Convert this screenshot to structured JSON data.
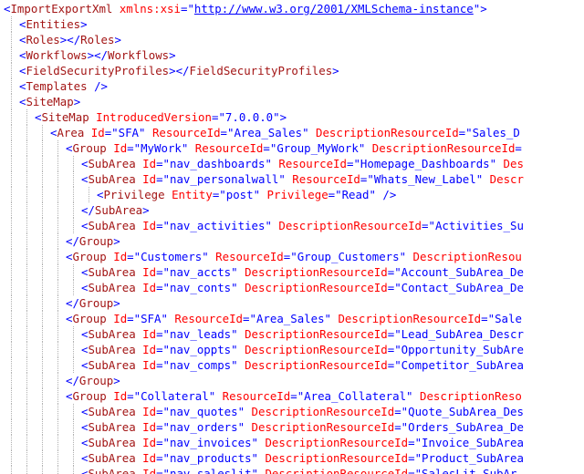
{
  "document": {
    "type": "xml",
    "colors": {
      "punctuation": "#0000ff",
      "element_name": "#a31515",
      "attribute_name": "#ff0000",
      "attribute_value": "#0000ff",
      "indent_guide": "#b0b0b0"
    },
    "lines": [
      {
        "indent": 0,
        "tokens": [
          {
            "k": "p",
            "t": "<"
          },
          {
            "k": "n",
            "t": "ImportExportXml"
          },
          {
            "k": "a",
            "t": " xmlns:xsi"
          },
          {
            "k": "p",
            "t": "=\""
          },
          {
            "k": "l",
            "t": "http://www.w3.org/2001/XMLSchema-instance"
          },
          {
            "k": "p",
            "t": "\">"
          }
        ]
      },
      {
        "indent": 1,
        "tokens": [
          {
            "k": "p",
            "t": "<"
          },
          {
            "k": "n",
            "t": "Entities"
          },
          {
            "k": "p",
            "t": ">"
          }
        ]
      },
      {
        "indent": 1,
        "tokens": [
          {
            "k": "p",
            "t": "<"
          },
          {
            "k": "n",
            "t": "Roles"
          },
          {
            "k": "p",
            "t": "></"
          },
          {
            "k": "n",
            "t": "Roles"
          },
          {
            "k": "p",
            "t": ">"
          }
        ]
      },
      {
        "indent": 1,
        "tokens": [
          {
            "k": "p",
            "t": "<"
          },
          {
            "k": "n",
            "t": "Workflows"
          },
          {
            "k": "p",
            "t": "></"
          },
          {
            "k": "n",
            "t": "Workflows"
          },
          {
            "k": "p",
            "t": ">"
          }
        ]
      },
      {
        "indent": 1,
        "tokens": [
          {
            "k": "p",
            "t": "<"
          },
          {
            "k": "n",
            "t": "FieldSecurityProfiles"
          },
          {
            "k": "p",
            "t": "></"
          },
          {
            "k": "n",
            "t": "FieldSecurityProfiles"
          },
          {
            "k": "p",
            "t": ">"
          }
        ]
      },
      {
        "indent": 1,
        "tokens": [
          {
            "k": "p",
            "t": "<"
          },
          {
            "k": "n",
            "t": "Templates"
          },
          {
            "k": "p",
            "t": " />"
          }
        ]
      },
      {
        "indent": 1,
        "tokens": [
          {
            "k": "p",
            "t": "<"
          },
          {
            "k": "n",
            "t": "SiteMap"
          },
          {
            "k": "p",
            "t": ">"
          }
        ]
      },
      {
        "indent": 2,
        "tokens": [
          {
            "k": "p",
            "t": "<"
          },
          {
            "k": "n",
            "t": "SiteMap"
          },
          {
            "k": "a",
            "t": " IntroducedVersion"
          },
          {
            "k": "p",
            "t": "="
          },
          {
            "k": "v",
            "t": "\"7.0.0.0\""
          },
          {
            "k": "p",
            "t": ">"
          }
        ]
      },
      {
        "indent": 3,
        "tokens": [
          {
            "k": "p",
            "t": "<"
          },
          {
            "k": "n",
            "t": "Area"
          },
          {
            "k": "a",
            "t": " Id"
          },
          {
            "k": "p",
            "t": "="
          },
          {
            "k": "v",
            "t": "\"SFA\""
          },
          {
            "k": "a",
            "t": " ResourceId"
          },
          {
            "k": "p",
            "t": "="
          },
          {
            "k": "v",
            "t": "\"Area_Sales\""
          },
          {
            "k": "a",
            "t": " DescriptionResourceId"
          },
          {
            "k": "p",
            "t": "="
          },
          {
            "k": "v",
            "t": "\"Sales_D"
          }
        ]
      },
      {
        "indent": 4,
        "tokens": [
          {
            "k": "p",
            "t": "<"
          },
          {
            "k": "n",
            "t": "Group"
          },
          {
            "k": "a",
            "t": " Id"
          },
          {
            "k": "p",
            "t": "="
          },
          {
            "k": "v",
            "t": "\"MyWork\""
          },
          {
            "k": "a",
            "t": " ResourceId"
          },
          {
            "k": "p",
            "t": "="
          },
          {
            "k": "v",
            "t": "\"Group_MyWork\""
          },
          {
            "k": "a",
            "t": " DescriptionResourceId"
          },
          {
            "k": "p",
            "t": "="
          }
        ]
      },
      {
        "indent": 5,
        "tokens": [
          {
            "k": "p",
            "t": "<"
          },
          {
            "k": "n",
            "t": "SubArea"
          },
          {
            "k": "a",
            "t": " Id"
          },
          {
            "k": "p",
            "t": "="
          },
          {
            "k": "v",
            "t": "\"nav_dashboards\""
          },
          {
            "k": "a",
            "t": " ResourceId"
          },
          {
            "k": "p",
            "t": "="
          },
          {
            "k": "v",
            "t": "\"Homepage_Dashboards\""
          },
          {
            "k": "a",
            "t": " Des"
          }
        ]
      },
      {
        "indent": 5,
        "tokens": [
          {
            "k": "p",
            "t": "<"
          },
          {
            "k": "n",
            "t": "SubArea"
          },
          {
            "k": "a",
            "t": " Id"
          },
          {
            "k": "p",
            "t": "="
          },
          {
            "k": "v",
            "t": "\"nav_personalwall\""
          },
          {
            "k": "a",
            "t": " ResourceId"
          },
          {
            "k": "p",
            "t": "="
          },
          {
            "k": "v",
            "t": "\"Whats_New_Label\""
          },
          {
            "k": "a",
            "t": " Descr"
          }
        ]
      },
      {
        "indent": 6,
        "tokens": [
          {
            "k": "p",
            "t": "<"
          },
          {
            "k": "n",
            "t": "Privilege"
          },
          {
            "k": "a",
            "t": " Entity"
          },
          {
            "k": "p",
            "t": "="
          },
          {
            "k": "v",
            "t": "\"post\""
          },
          {
            "k": "a",
            "t": " Privilege"
          },
          {
            "k": "p",
            "t": "="
          },
          {
            "k": "v",
            "t": "\"Read\""
          },
          {
            "k": "p",
            "t": " />"
          }
        ]
      },
      {
        "indent": 5,
        "tokens": [
          {
            "k": "p",
            "t": "</"
          },
          {
            "k": "n",
            "t": "SubArea"
          },
          {
            "k": "p",
            "t": ">"
          }
        ]
      },
      {
        "indent": 5,
        "tokens": [
          {
            "k": "p",
            "t": "<"
          },
          {
            "k": "n",
            "t": "SubArea"
          },
          {
            "k": "a",
            "t": " Id"
          },
          {
            "k": "p",
            "t": "="
          },
          {
            "k": "v",
            "t": "\"nav_activities\""
          },
          {
            "k": "a",
            "t": " DescriptionResourceId"
          },
          {
            "k": "p",
            "t": "="
          },
          {
            "k": "v",
            "t": "\"Activities_Su"
          }
        ]
      },
      {
        "indent": 4,
        "tokens": [
          {
            "k": "p",
            "t": "</"
          },
          {
            "k": "n",
            "t": "Group"
          },
          {
            "k": "p",
            "t": ">"
          }
        ]
      },
      {
        "indent": 4,
        "tokens": [
          {
            "k": "p",
            "t": "<"
          },
          {
            "k": "n",
            "t": "Group"
          },
          {
            "k": "a",
            "t": " Id"
          },
          {
            "k": "p",
            "t": "="
          },
          {
            "k": "v",
            "t": "\"Customers\""
          },
          {
            "k": "a",
            "t": " ResourceId"
          },
          {
            "k": "p",
            "t": "="
          },
          {
            "k": "v",
            "t": "\"Group_Customers\""
          },
          {
            "k": "a",
            "t": " DescriptionResou"
          }
        ]
      },
      {
        "indent": 5,
        "tokens": [
          {
            "k": "p",
            "t": "<"
          },
          {
            "k": "n",
            "t": "SubArea"
          },
          {
            "k": "a",
            "t": " Id"
          },
          {
            "k": "p",
            "t": "="
          },
          {
            "k": "v",
            "t": "\"nav_accts\""
          },
          {
            "k": "a",
            "t": " DescriptionResourceId"
          },
          {
            "k": "p",
            "t": "="
          },
          {
            "k": "v",
            "t": "\"Account_SubArea_De"
          }
        ]
      },
      {
        "indent": 5,
        "tokens": [
          {
            "k": "p",
            "t": "<"
          },
          {
            "k": "n",
            "t": "SubArea"
          },
          {
            "k": "a",
            "t": " Id"
          },
          {
            "k": "p",
            "t": "="
          },
          {
            "k": "v",
            "t": "\"nav_conts\""
          },
          {
            "k": "a",
            "t": " DescriptionResourceId"
          },
          {
            "k": "p",
            "t": "="
          },
          {
            "k": "v",
            "t": "\"Contact_SubArea_De"
          }
        ]
      },
      {
        "indent": 4,
        "tokens": [
          {
            "k": "p",
            "t": "</"
          },
          {
            "k": "n",
            "t": "Group"
          },
          {
            "k": "p",
            "t": ">"
          }
        ]
      },
      {
        "indent": 4,
        "tokens": [
          {
            "k": "p",
            "t": "<"
          },
          {
            "k": "n",
            "t": "Group"
          },
          {
            "k": "a",
            "t": " Id"
          },
          {
            "k": "p",
            "t": "="
          },
          {
            "k": "v",
            "t": "\"SFA\""
          },
          {
            "k": "a",
            "t": " ResourceId"
          },
          {
            "k": "p",
            "t": "="
          },
          {
            "k": "v",
            "t": "\"Area_Sales\""
          },
          {
            "k": "a",
            "t": " DescriptionResourceId"
          },
          {
            "k": "p",
            "t": "="
          },
          {
            "k": "v",
            "t": "\"Sale"
          }
        ]
      },
      {
        "indent": 5,
        "tokens": [
          {
            "k": "p",
            "t": "<"
          },
          {
            "k": "n",
            "t": "SubArea"
          },
          {
            "k": "a",
            "t": " Id"
          },
          {
            "k": "p",
            "t": "="
          },
          {
            "k": "v",
            "t": "\"nav_leads\""
          },
          {
            "k": "a",
            "t": " DescriptionResourceId"
          },
          {
            "k": "p",
            "t": "="
          },
          {
            "k": "v",
            "t": "\"Lead_SubArea_Descr"
          }
        ]
      },
      {
        "indent": 5,
        "tokens": [
          {
            "k": "p",
            "t": "<"
          },
          {
            "k": "n",
            "t": "SubArea"
          },
          {
            "k": "a",
            "t": " Id"
          },
          {
            "k": "p",
            "t": "="
          },
          {
            "k": "v",
            "t": "\"nav_oppts\""
          },
          {
            "k": "a",
            "t": " DescriptionResourceId"
          },
          {
            "k": "p",
            "t": "="
          },
          {
            "k": "v",
            "t": "\"Opportunity_SubAre"
          }
        ]
      },
      {
        "indent": 5,
        "tokens": [
          {
            "k": "p",
            "t": "<"
          },
          {
            "k": "n",
            "t": "SubArea"
          },
          {
            "k": "a",
            "t": " Id"
          },
          {
            "k": "p",
            "t": "="
          },
          {
            "k": "v",
            "t": "\"nav_comps\""
          },
          {
            "k": "a",
            "t": " DescriptionResourceId"
          },
          {
            "k": "p",
            "t": "="
          },
          {
            "k": "v",
            "t": "\"Competitor_SubArea"
          }
        ]
      },
      {
        "indent": 4,
        "tokens": [
          {
            "k": "p",
            "t": "</"
          },
          {
            "k": "n",
            "t": "Group"
          },
          {
            "k": "p",
            "t": ">"
          }
        ]
      },
      {
        "indent": 4,
        "tokens": [
          {
            "k": "p",
            "t": "<"
          },
          {
            "k": "n",
            "t": "Group"
          },
          {
            "k": "a",
            "t": " Id"
          },
          {
            "k": "p",
            "t": "="
          },
          {
            "k": "v",
            "t": "\"Collateral\""
          },
          {
            "k": "a",
            "t": " ResourceId"
          },
          {
            "k": "p",
            "t": "="
          },
          {
            "k": "v",
            "t": "\"Area_Collateral\""
          },
          {
            "k": "a",
            "t": " DescriptionReso"
          }
        ]
      },
      {
        "indent": 5,
        "tokens": [
          {
            "k": "p",
            "t": "<"
          },
          {
            "k": "n",
            "t": "SubArea"
          },
          {
            "k": "a",
            "t": " Id"
          },
          {
            "k": "p",
            "t": "="
          },
          {
            "k": "v",
            "t": "\"nav_quotes\""
          },
          {
            "k": "a",
            "t": " DescriptionResourceId"
          },
          {
            "k": "p",
            "t": "="
          },
          {
            "k": "v",
            "t": "\"Quote_SubArea_Des"
          }
        ]
      },
      {
        "indent": 5,
        "tokens": [
          {
            "k": "p",
            "t": "<"
          },
          {
            "k": "n",
            "t": "SubArea"
          },
          {
            "k": "a",
            "t": " Id"
          },
          {
            "k": "p",
            "t": "="
          },
          {
            "k": "v",
            "t": "\"nav_orders\""
          },
          {
            "k": "a",
            "t": " DescriptionResourceId"
          },
          {
            "k": "p",
            "t": "="
          },
          {
            "k": "v",
            "t": "\"Orders_SubArea_De"
          }
        ]
      },
      {
        "indent": 5,
        "tokens": [
          {
            "k": "p",
            "t": "<"
          },
          {
            "k": "n",
            "t": "SubArea"
          },
          {
            "k": "a",
            "t": " Id"
          },
          {
            "k": "p",
            "t": "="
          },
          {
            "k": "v",
            "t": "\"nav_invoices\""
          },
          {
            "k": "a",
            "t": " DescriptionResourceId"
          },
          {
            "k": "p",
            "t": "="
          },
          {
            "k": "v",
            "t": "\"Invoice_SubArea"
          }
        ]
      },
      {
        "indent": 5,
        "tokens": [
          {
            "k": "p",
            "t": "<"
          },
          {
            "k": "n",
            "t": "SubArea"
          },
          {
            "k": "a",
            "t": " Id"
          },
          {
            "k": "p",
            "t": "="
          },
          {
            "k": "v",
            "t": "\"nav_products\""
          },
          {
            "k": "a",
            "t": " DescriptionResourceId"
          },
          {
            "k": "p",
            "t": "="
          },
          {
            "k": "v",
            "t": "\"Product_SubArea"
          }
        ]
      },
      {
        "indent": 5,
        "tokens": [
          {
            "k": "p",
            "t": "<"
          },
          {
            "k": "n",
            "t": "SubArea"
          },
          {
            "k": "a",
            "t": " Id"
          },
          {
            "k": "p",
            "t": "="
          },
          {
            "k": "v",
            "t": "\"nav_saleslit\""
          },
          {
            "k": "a",
            "t": " DescriptionResourceId"
          },
          {
            "k": "p",
            "t": "="
          },
          {
            "k": "v",
            "t": "\"SalesLit_SubAr"
          }
        ]
      }
    ]
  }
}
